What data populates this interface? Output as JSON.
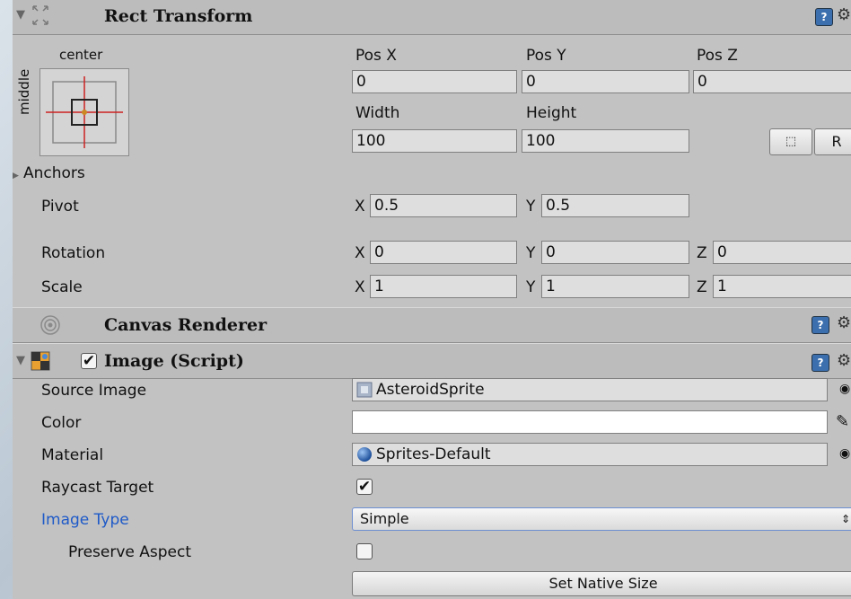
{
  "rect_transform": {
    "title": "Rect Transform",
    "anchor_preset": {
      "horizontal": "center",
      "vertical": "middle"
    },
    "pos_x_label": "Pos X",
    "pos_y_label": "Pos Y",
    "pos_z_label": "Pos Z",
    "pos_x": "0",
    "pos_y": "0",
    "pos_z": "0",
    "width_label": "Width",
    "height_label": "Height",
    "width": "100",
    "height": "100",
    "raw_edit_label": "R",
    "anchors_label": "Anchors",
    "pivot_label": "Pivot",
    "pivot_x": "0.5",
    "pivot_y": "0.5",
    "rotation_label": "Rotation",
    "rot_x": "0",
    "rot_y": "0",
    "rot_z": "0",
    "scale_label": "Scale",
    "scale_x": "1",
    "scale_y": "1",
    "scale_z": "1",
    "axis_x": "X",
    "axis_y": "Y",
    "axis_z": "Z"
  },
  "canvas_renderer": {
    "title": "Canvas Renderer"
  },
  "image_script": {
    "title": "Image (Script)",
    "enabled": true,
    "source_image_label": "Source Image",
    "source_image": "AsteroidSprite",
    "color_label": "Color",
    "color_value": "#ffffff",
    "material_label": "Material",
    "material": "Sprites-Default",
    "raycast_label": "Raycast Target",
    "raycast_checked": true,
    "image_type_label": "Image Type",
    "image_type": "Simple",
    "preserve_label": "Preserve Aspect",
    "preserve_checked": false,
    "native_size_button": "Set Native Size"
  },
  "colors": {
    "panel_bg": "#c2c2c2",
    "header_bg": "#bcbcbc",
    "field_bg": "#dedede",
    "label_highlight": "#1e5ac8",
    "anchor_red": "#cc2222"
  },
  "icons": [
    "fold-arrow-icon",
    "rect-transform-icon",
    "help-icon",
    "gear-icon",
    "anchor-preset-icon",
    "canvas-renderer-icon",
    "image-component-icon",
    "sprite-icon",
    "material-sphere-icon",
    "eyedropper-icon",
    "object-picker-icon",
    "blueprint-mode-icon"
  ]
}
